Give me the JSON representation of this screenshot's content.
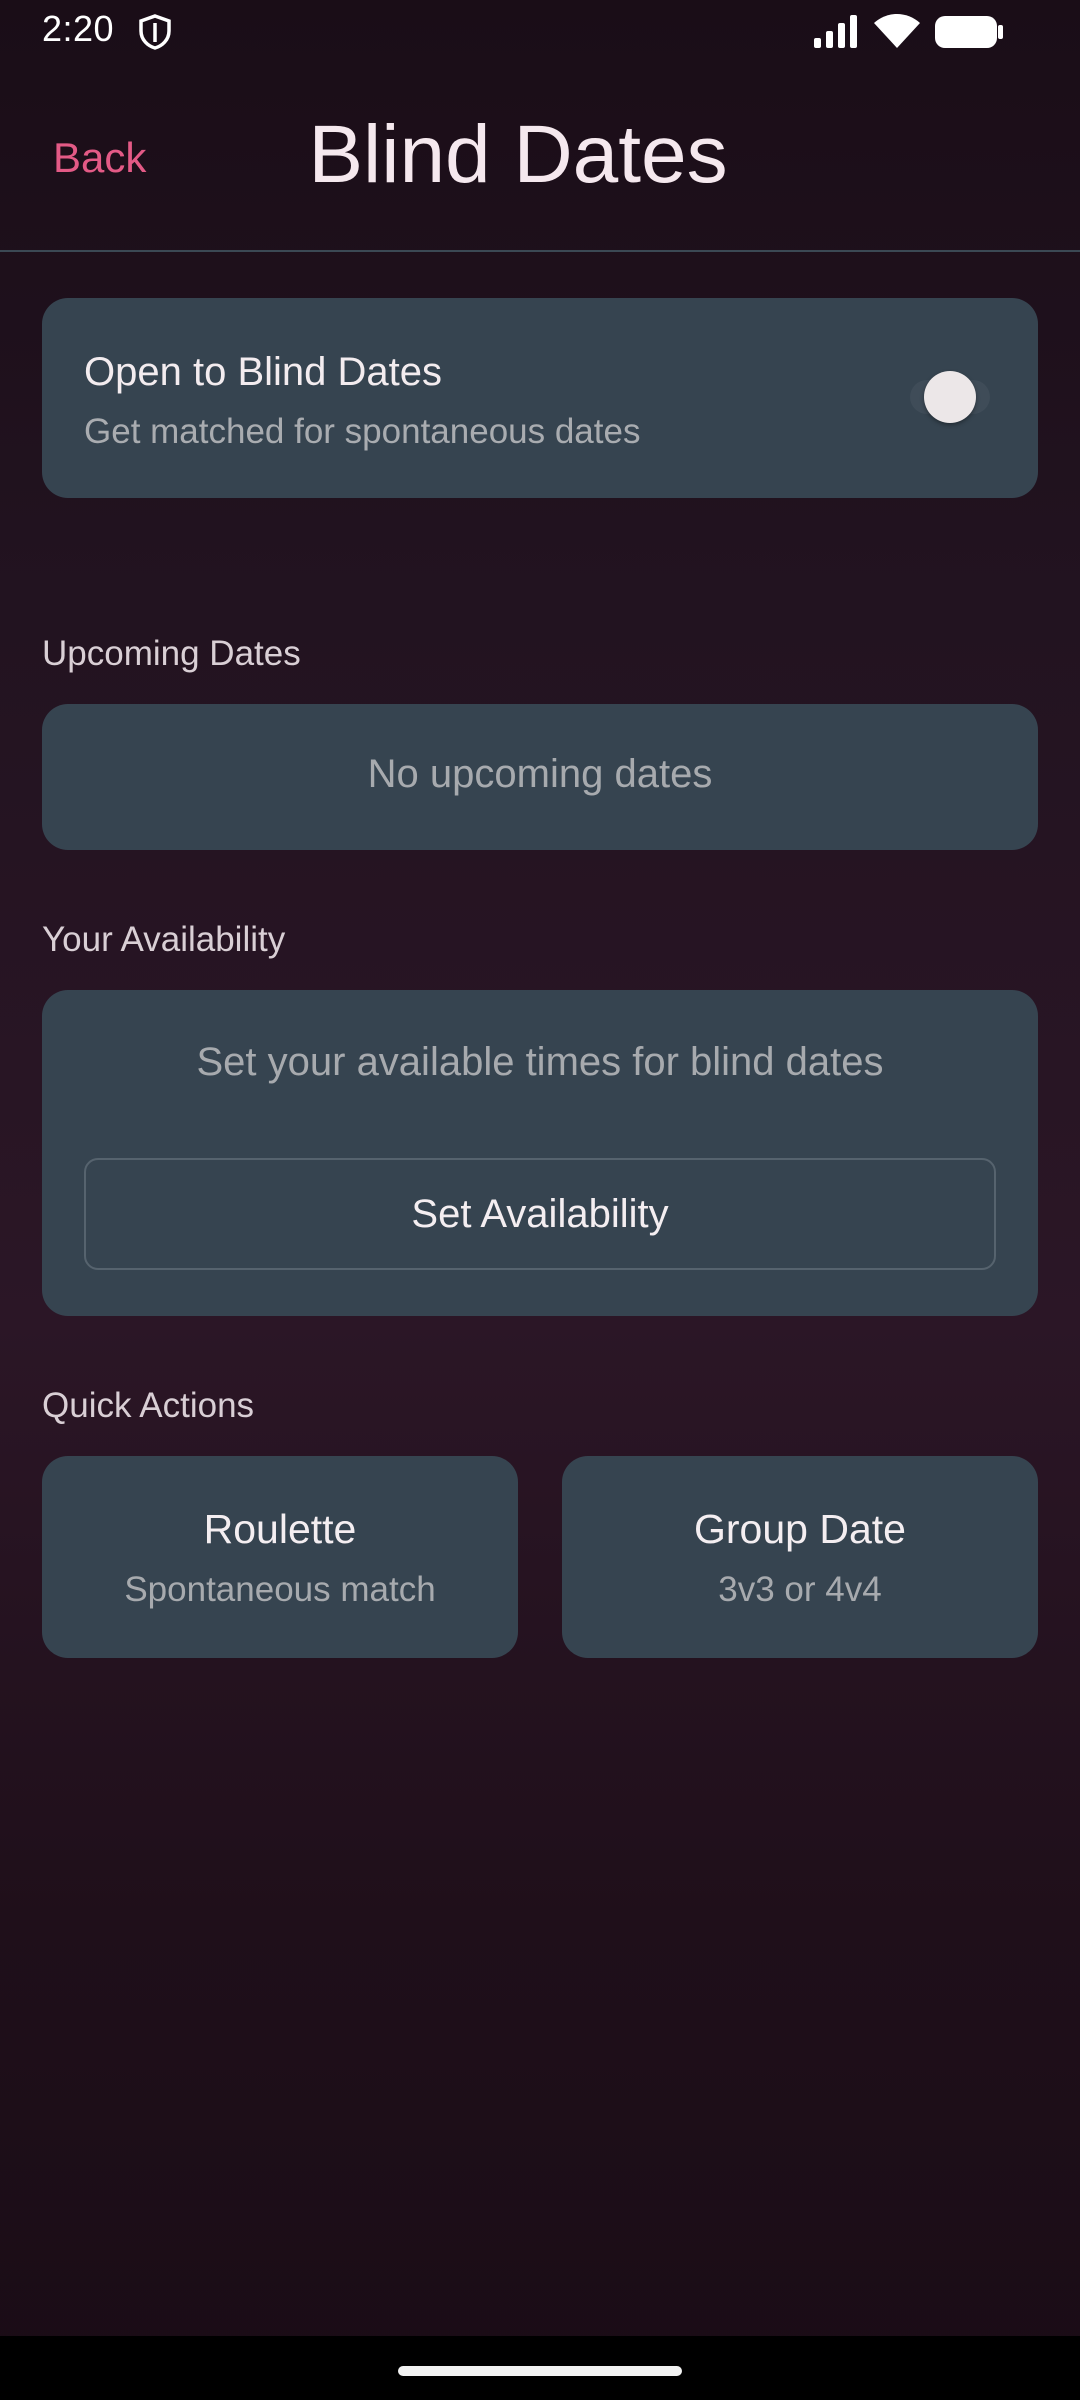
{
  "status_bar": {
    "time": "2:20",
    "icons": [
      "shield-icon",
      "signal-icon",
      "wifi-icon",
      "battery-icon"
    ]
  },
  "header": {
    "back_label": "Back",
    "title": "Blind Dates"
  },
  "blind_dates_toggle": {
    "title": "Open to Blind Dates",
    "subtitle": "Get matched for spontaneous dates",
    "enabled": false
  },
  "upcoming": {
    "heading": "Upcoming Dates",
    "empty_text": "No upcoming dates"
  },
  "availability": {
    "heading": "Your Availability",
    "description": "Set your available times for blind dates",
    "button_label": "Set Availability"
  },
  "quick_actions": {
    "heading": "Quick Actions",
    "items": [
      {
        "title": "Roulette",
        "subtitle": "Spontaneous match"
      },
      {
        "title": "Group Date",
        "subtitle": "3v3 or 4v4"
      }
    ]
  },
  "colors": {
    "accent": "#e35a86",
    "card": "#364450",
    "background": "#221320"
  }
}
